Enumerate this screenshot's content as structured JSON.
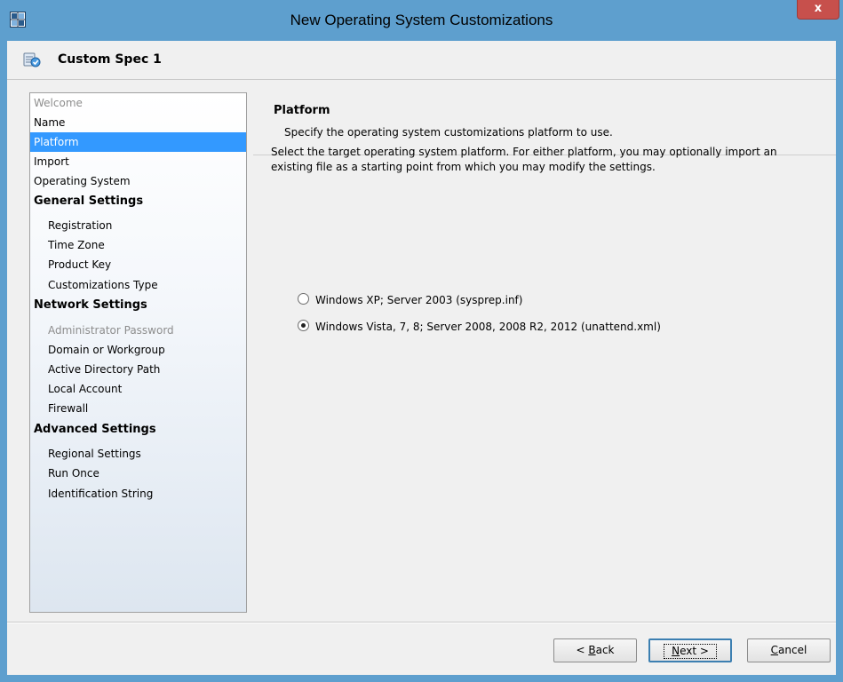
{
  "window": {
    "title": "New Operating System Customizations",
    "close_label": "x"
  },
  "spec": {
    "title": "Custom Spec 1"
  },
  "nav": {
    "items": [
      {
        "label": "Welcome",
        "state": "disabled"
      },
      {
        "label": "Name",
        "state": "normal"
      },
      {
        "label": "Platform",
        "state": "selected"
      },
      {
        "label": "Import",
        "state": "normal"
      },
      {
        "label": "Operating System",
        "state": "normal"
      },
      {
        "label": "General Settings",
        "state": "heading"
      },
      {
        "label": "Registration",
        "state": "sub"
      },
      {
        "label": "Time Zone",
        "state": "sub"
      },
      {
        "label": "Product Key",
        "state": "sub"
      },
      {
        "label": "Customizations Type",
        "state": "sub"
      },
      {
        "label": "Network Settings",
        "state": "heading"
      },
      {
        "label": "Administrator Password",
        "state": "sub-disabled"
      },
      {
        "label": "Domain or Workgroup",
        "state": "sub"
      },
      {
        "label": "Active Directory Path",
        "state": "sub"
      },
      {
        "label": "Local Account",
        "state": "sub"
      },
      {
        "label": "Firewall",
        "state": "sub"
      },
      {
        "label": "Advanced Settings",
        "state": "heading"
      },
      {
        "label": "Regional Settings",
        "state": "sub"
      },
      {
        "label": "Run Once",
        "state": "sub"
      },
      {
        "label": "Identification String",
        "state": "sub"
      }
    ]
  },
  "page": {
    "title": "Platform",
    "subtitle": "Specify the operating system customizations platform to use.",
    "description": "Select the target operating system platform.  For either platform, you may optionally import an existing file as a starting point from which you may modify the settings.",
    "options": [
      {
        "label": "Windows XP; Server 2003 (sysprep.inf)",
        "checked": false
      },
      {
        "label": "Windows Vista, 7, 8; Server 2008, 2008 R2, 2012 (unattend.xml)",
        "checked": true
      }
    ]
  },
  "buttons": {
    "back": {
      "mnemonic": "B",
      "before": "< ",
      "after": "ack"
    },
    "next": {
      "mnemonic": "N",
      "before": "",
      "after": "ext >"
    },
    "cancel": {
      "mnemonic": "C",
      "before": "",
      "after": "ancel"
    }
  },
  "colors": {
    "title_bar": "#5e9fce",
    "selection": "#3399ff",
    "close_button": "#c7504c"
  }
}
